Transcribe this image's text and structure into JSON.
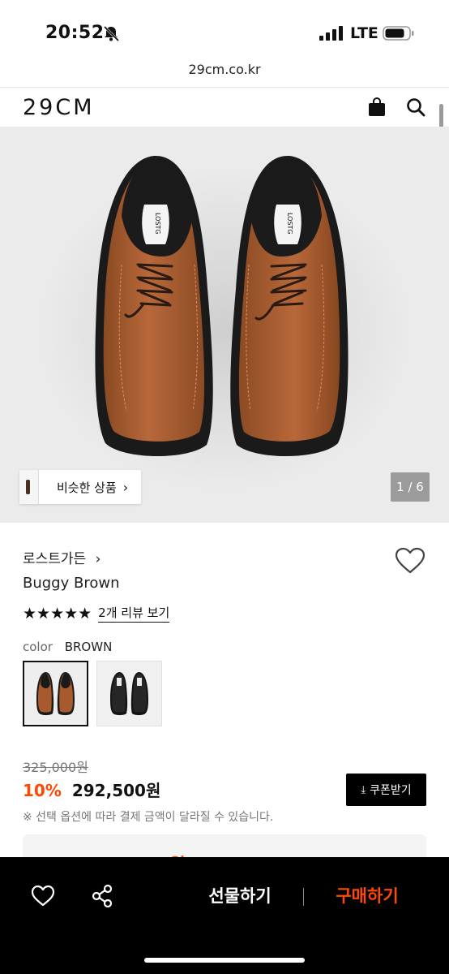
{
  "status_bar": {
    "time": "20:52",
    "network": "LTE"
  },
  "browser": {
    "url": "29cm.co.kr"
  },
  "header": {
    "logo": "29CM"
  },
  "gallery": {
    "similar_label": "비슷한 상품",
    "chevron": "›",
    "page_indicator": "1 / 6",
    "shoe_tag": "LOSTG"
  },
  "product": {
    "brand": "로스트가든",
    "brand_chevron": "›",
    "name": "Buggy Brown",
    "stars": "★★★★★",
    "rating": 5,
    "review_link": "2개 리뷰 보기",
    "color_label": "color",
    "color_value": "BROWN",
    "original_price": "325,000원",
    "discount_rate": "10%",
    "sale_price": "292,500원",
    "coupon_label": "쿠폰받기",
    "option_notice": "※ 선택 옵션에 따라 결제 금액이 달라질 수 있습니다.",
    "benefit_price_partial": "21% 257,500원"
  },
  "bottom_bar": {
    "gift_label": "선물하기",
    "buy_label": "구매하기"
  },
  "colors": {
    "accent": "#ff4800",
    "black": "#000000",
    "hero_bg": "#ebebeb"
  },
  "icons": [
    "bell-slash-icon",
    "signal-icon",
    "battery-icon",
    "shopping-bag-icon",
    "search-icon",
    "heart-icon",
    "share-icon",
    "download-icon",
    "chevron-right-icon"
  ]
}
